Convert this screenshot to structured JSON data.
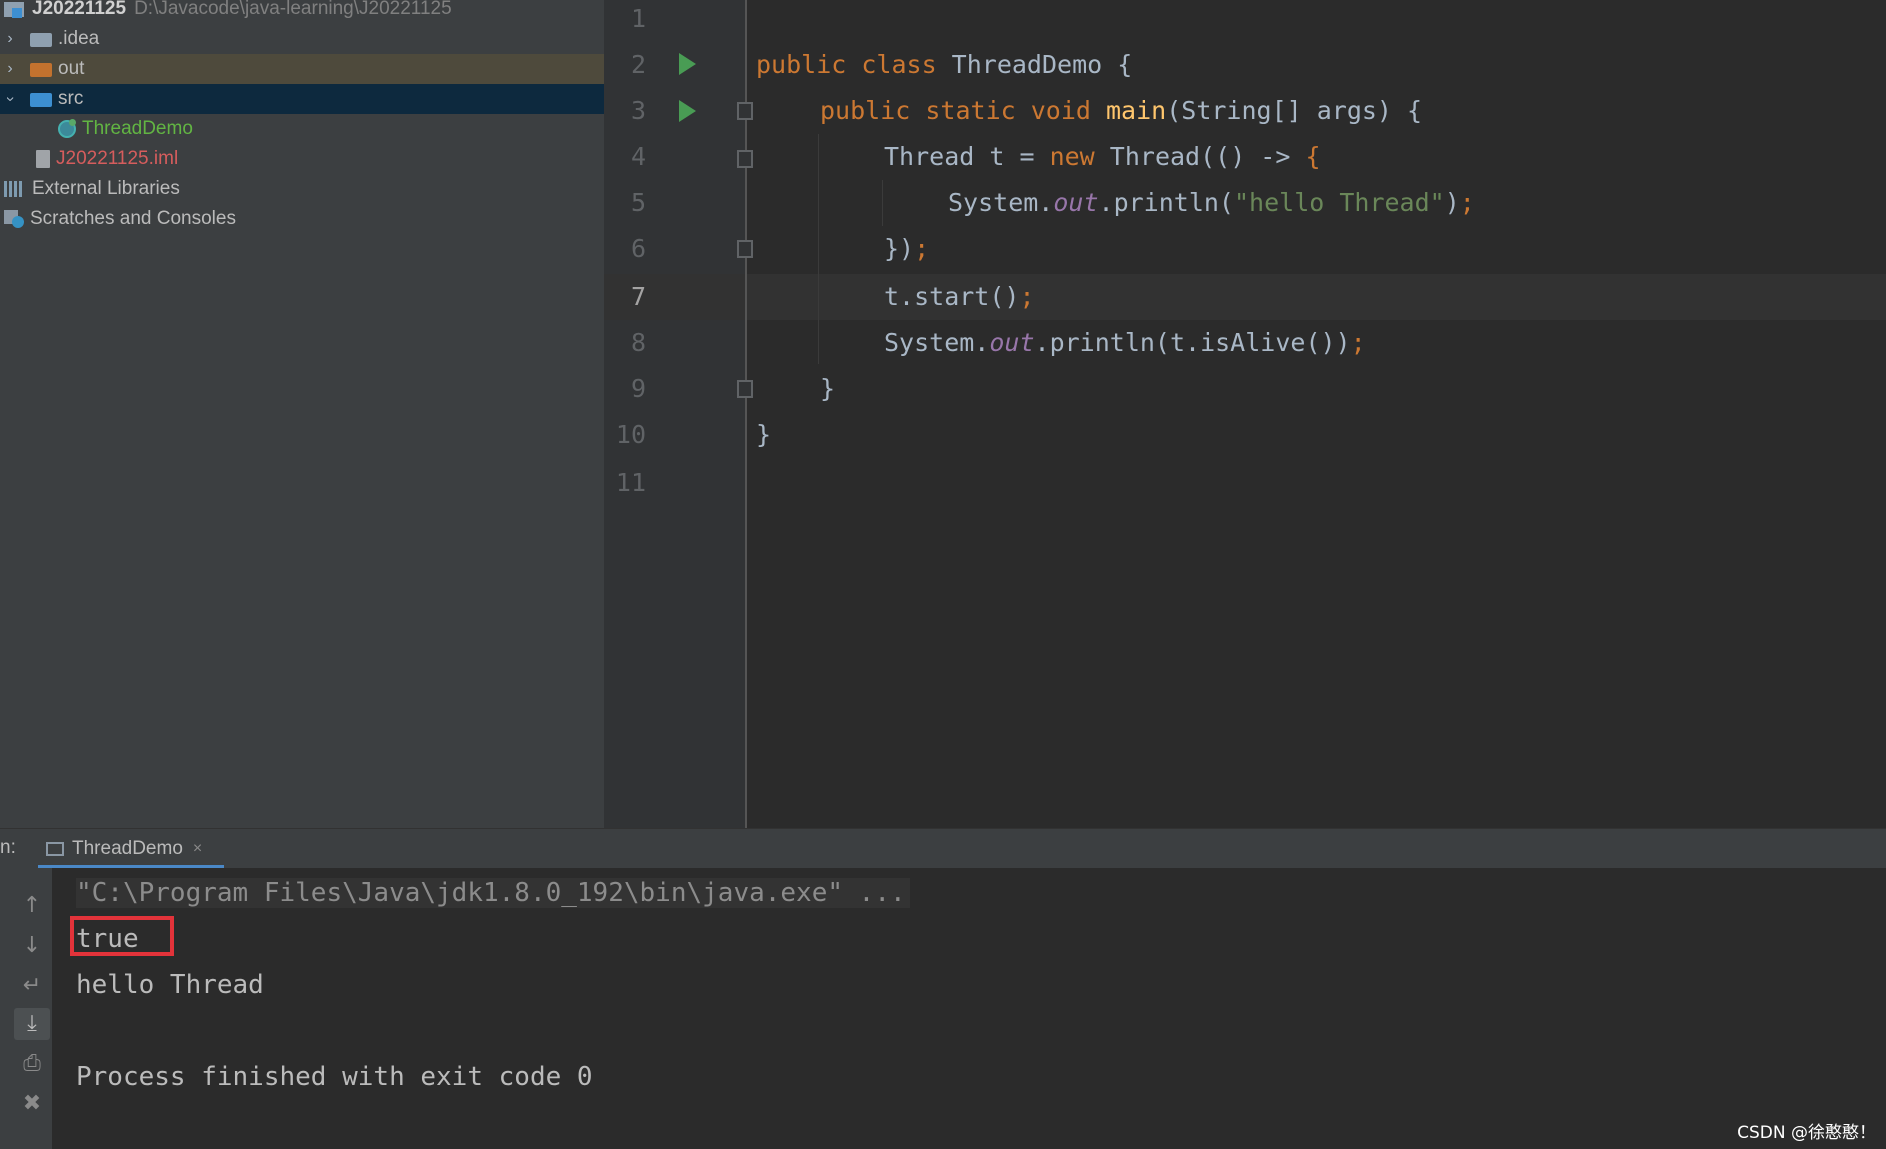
{
  "project": {
    "root_name": "J20221125",
    "root_path": "D:\\Javacode\\java-learning\\J20221125",
    "items": [
      {
        "label": "idea_label",
        "text": ".idea"
      },
      {
        "text": "out"
      },
      {
        "text": "src"
      },
      {
        "text": "ThreadDemo"
      },
      {
        "text": "J20221125.iml"
      },
      {
        "text": "External Libraries"
      },
      {
        "text": "Scratches and Consoles"
      }
    ]
  },
  "editor": {
    "line_numbers": [
      "1",
      "2",
      "3",
      "4",
      "5",
      "6",
      "7",
      "8",
      "9",
      "10",
      "11"
    ],
    "current_line": "7",
    "code": {
      "l2_kw": "public class",
      "l2_rest": " ThreadDemo {",
      "l3_kw1": "public static void",
      "l3_fn": "main",
      "l3_rest": "(String[] args) {",
      "l4_a": "Thread t = ",
      "l4_kw": "new",
      "l4_b": " Thread(() -> ",
      "l4_brace": "{",
      "l5_a": "System.",
      "l5_out": "out",
      "l5_b": ".println(",
      "l5_str": "\"hello Thread\"",
      "l5_c": ")",
      "l5_semi": ";",
      "l6_a": "})",
      "l6_semi": ";",
      "l7_a": "t.start()",
      "l7_semi": ";",
      "l8_a": "System.",
      "l8_out": "out",
      "l8_b": ".println(t.isAlive())",
      "l8_semi": ";",
      "l9": "}",
      "l10": "}"
    }
  },
  "run": {
    "prefix": "n:",
    "tab_label": "ThreadDemo",
    "tab_close": "×",
    "console": {
      "command": "\"C:\\Program Files\\Java\\jdk1.8.0_192\\bin\\java.exe\" ...",
      "line1": "true",
      "line2": "hello Thread",
      "line3": "Process finished with exit code 0"
    },
    "toolbar_icons": [
      "arrow-up-icon",
      "arrow-down-icon",
      "soft-wrap-icon",
      "scroll-to-end-icon",
      "print-icon",
      "trash-icon"
    ]
  },
  "watermark": "CSDN @徐憨憨！",
  "colors": {
    "keyword": "#cc7832",
    "method": "#ffc66d",
    "string": "#6a8759",
    "field": "#9876aa",
    "highlight_box": "#e2333a",
    "run_icon": "#499c54"
  }
}
